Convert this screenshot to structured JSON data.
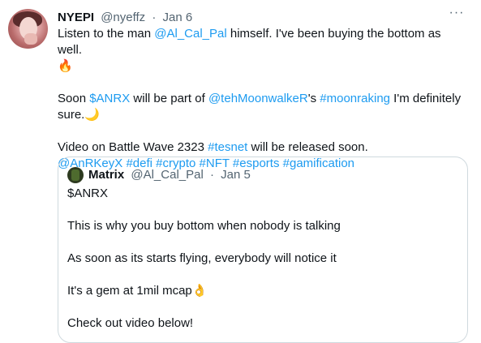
{
  "tweet": {
    "author_name": "NYEPI",
    "handle": "@nyeffz",
    "separator": "·",
    "date": "Jan 6",
    "more_label": "···",
    "line1_pre": "Listen to the man ",
    "line1_mention": "@Al_Cal_Pal",
    "line1_post": " himself. I've been buying the bottom as well.",
    "line1_emoji": "🔥",
    "line2_pre": "Soon ",
    "line2_cashtag": "$ANRX",
    "line2_mid": " will be part of ",
    "line2_mention": "@tehMoonwalkeR",
    "line2_mid2": "'s ",
    "line2_hashtag": "#moonraking",
    "line2_post": " I'm definitely sure.",
    "line2_emoji": "🌙",
    "line3_pre": "Video on Battle Wave 2323 ",
    "line3_hashtag": "#tesnet",
    "line3_post": " will be released soon.",
    "line4_mention": "@AnRKeyX",
    "line4_tags": [
      "#defi",
      "#crypto",
      "#NFT",
      "#esports",
      "#gamification"
    ]
  },
  "quoted": {
    "author_name": "Matrix",
    "handle": "@Al_Cal_Pal",
    "separator": "·",
    "date": "Jan 5",
    "lines": [
      "$ANRX",
      "This is why you buy bottom when nobody is talking",
      "As soon as its starts flying, everybody will notice it",
      "It's a gem at 1mil mcap",
      "Check out video below!"
    ],
    "gem_emoji": "👌"
  },
  "colors": {
    "link": "#1d9bf0",
    "text": "#0f1419",
    "muted": "#536471",
    "border": "#cfd9de"
  }
}
